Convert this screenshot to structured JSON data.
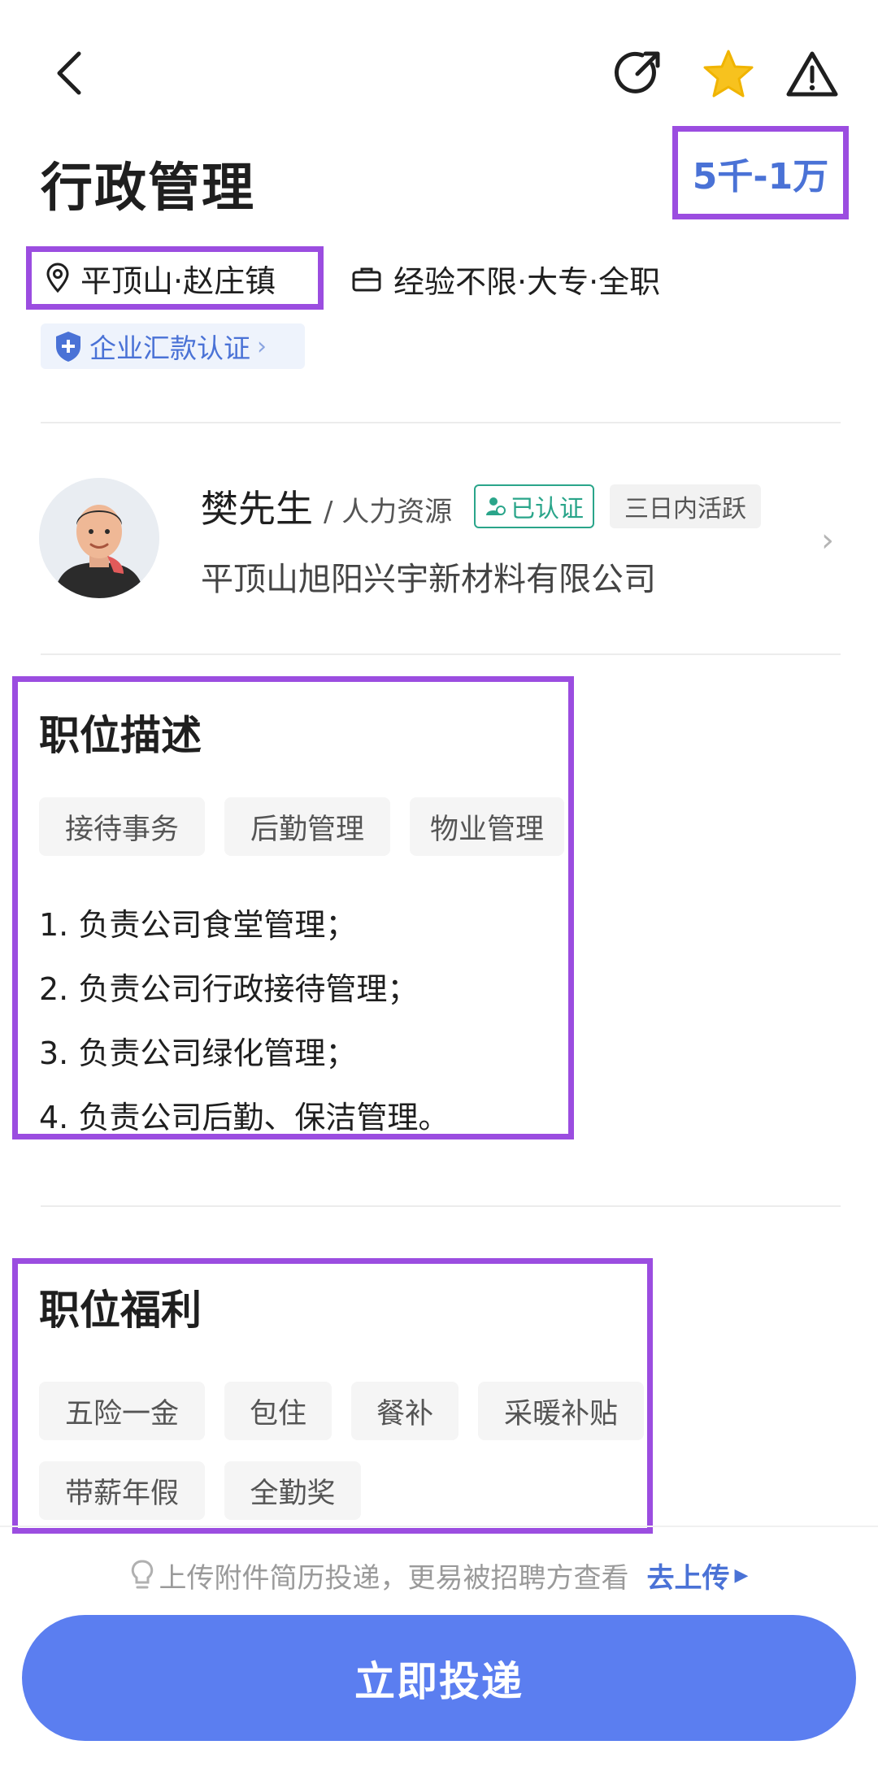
{
  "job": {
    "title": "行政管理",
    "salary": "5千-1万",
    "location": "平顶山·赵庄镇",
    "requirements": "经验不限·大专·全职",
    "certification": "企业汇款认证"
  },
  "recruiter": {
    "name": "樊先生",
    "role": "/ 人力资源",
    "verified_badge": "已认证",
    "active_badge": "三日内活跃",
    "company": "平顶山旭阳兴宇新材料有限公司"
  },
  "description": {
    "title": "职位描述",
    "tags": [
      "接待事务",
      "后勤管理",
      "物业管理"
    ],
    "lines": [
      "1. 负责公司食堂管理；",
      "2. 负责公司行政接待管理；",
      "3. 负责公司绿化管理；",
      "4. 负责公司后勤、保洁管理。"
    ]
  },
  "benefits": {
    "title": "职位福利",
    "tags": [
      "五险一金",
      "包住",
      "餐补",
      "采暖补贴",
      "带薪年假",
      "全勤奖"
    ]
  },
  "footer": {
    "tip": "上传附件简历投递，更易被招聘方查看",
    "upload_link": "去上传",
    "apply_button": "立即投递"
  },
  "colors": {
    "accent": "#5b7ef0",
    "link": "#4a72d6",
    "highlight_box": "#9b4de0",
    "verified": "#2aa58a"
  },
  "icons": [
    "back-icon",
    "share-icon",
    "star-icon",
    "warning-icon",
    "location-pin-icon",
    "briefcase-icon",
    "shield-icon",
    "bulb-icon"
  ]
}
